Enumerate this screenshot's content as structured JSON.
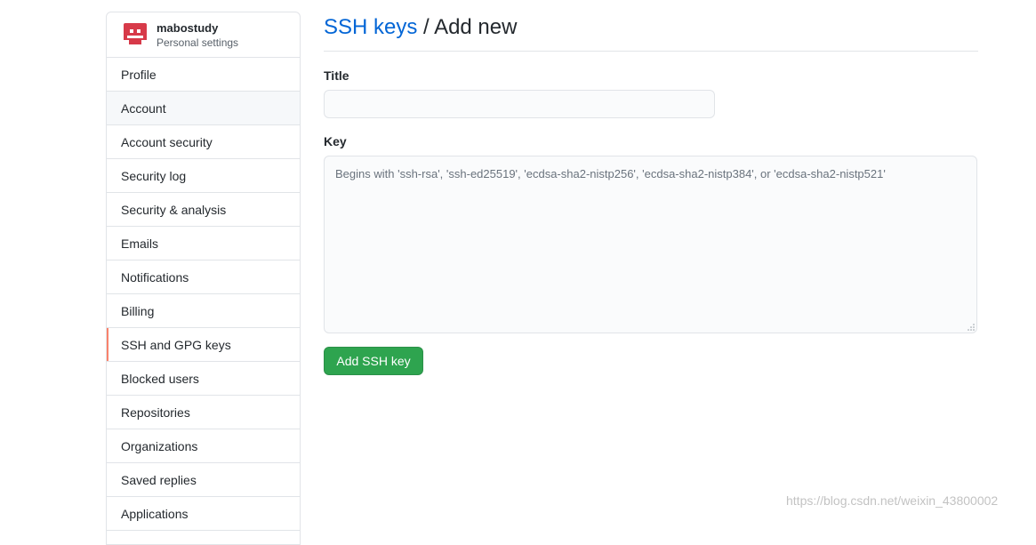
{
  "user": {
    "name": "mabostudy",
    "subtitle": "Personal settings"
  },
  "sidebar": {
    "items": [
      {
        "label": "Profile"
      },
      {
        "label": "Account"
      },
      {
        "label": "Account security"
      },
      {
        "label": "Security log"
      },
      {
        "label": "Security & analysis"
      },
      {
        "label": "Emails"
      },
      {
        "label": "Notifications"
      },
      {
        "label": "Billing"
      },
      {
        "label": "SSH and GPG keys"
      },
      {
        "label": "Blocked users"
      },
      {
        "label": "Repositories"
      },
      {
        "label": "Organizations"
      },
      {
        "label": "Saved replies"
      },
      {
        "label": "Applications"
      }
    ],
    "selected_index": 8,
    "hovered_index": 1
  },
  "header": {
    "breadcrumb_link": "SSH keys",
    "separator": "/",
    "current": "Add new"
  },
  "form": {
    "title_label": "Title",
    "title_value": "",
    "key_label": "Key",
    "key_value": "",
    "key_placeholder": "Begins with 'ssh-rsa', 'ssh-ed25519', 'ecdsa-sha2-nistp256', 'ecdsa-sha2-nistp384', or 'ecdsa-sha2-nistp521'",
    "submit_label": "Add SSH key"
  },
  "watermark": "https://blog.csdn.net/weixin_43800002",
  "colors": {
    "link": "#0366d6",
    "selected_marker": "#f9826c",
    "button_green": "#2ea44f",
    "avatar_red": "#d73a49"
  }
}
